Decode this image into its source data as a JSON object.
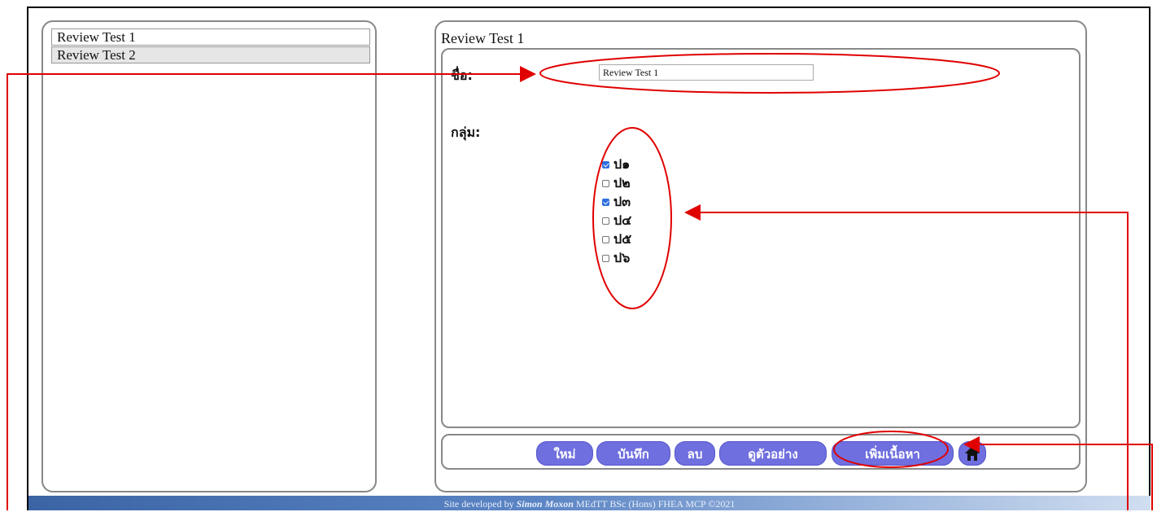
{
  "list": {
    "items": [
      {
        "label": "Review Test 1"
      },
      {
        "label": "Review Test 2"
      }
    ]
  },
  "editor": {
    "title": "Review Test 1",
    "name_label": "ชื่อ:",
    "name_value": "Review Test 1",
    "group_label": "กลุ่ม:",
    "groups": [
      {
        "label": "ป๑",
        "checked": true
      },
      {
        "label": "ป๒",
        "checked": false
      },
      {
        "label": "ป๓",
        "checked": true
      },
      {
        "label": "ป๔",
        "checked": false
      },
      {
        "label": "ป๕",
        "checked": false
      },
      {
        "label": "ป๖",
        "checked": false
      }
    ]
  },
  "toolbar": {
    "new_label": "ใหม่",
    "save_label": "บันทึก",
    "delete_label": "ลบ",
    "preview_label": "ดูตัวอย่าง",
    "add_content_label": "เพิ่มเนื้อหา",
    "home_icon": "home-icon"
  },
  "footer": {
    "prefix": "Site developed by",
    "author": "Simon Moxon",
    "credentials": "MEdTT  BSc (Hons)  FHEA  MCP  ©2021"
  },
  "colors": {
    "button": "#6f6fdf",
    "annotation": "#e00000",
    "checkbox_checked": "#2f6fde"
  }
}
